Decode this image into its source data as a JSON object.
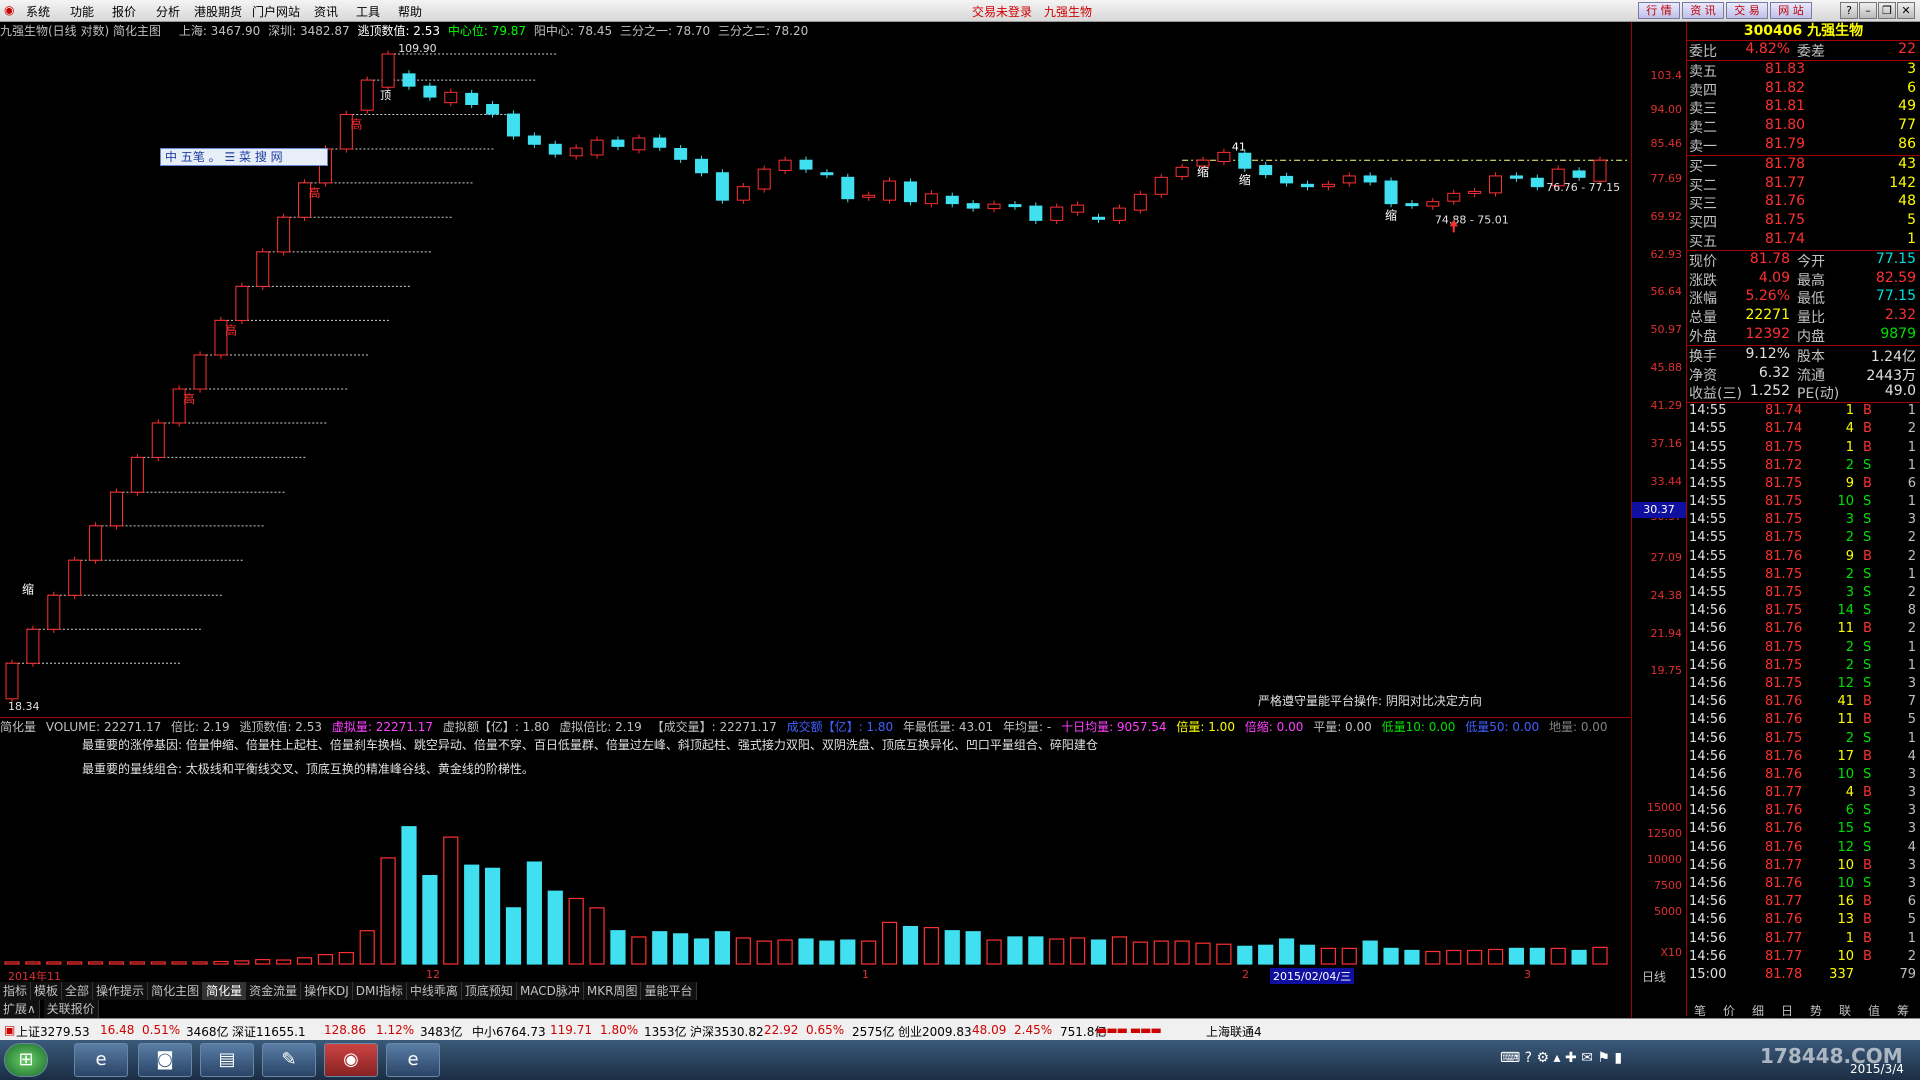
{
  "titlebar": {
    "menu": [
      "系统",
      "功能",
      "报价",
      "分析",
      "港股期货",
      "门户网站",
      "资讯",
      "工具",
      "帮助"
    ],
    "status": "交易未登录",
    "stock_name": "九强生物",
    "right_buttons": [
      "行 情",
      "资 讯",
      "交 易",
      "网 站"
    ]
  },
  "chart_header": {
    "title": "九强生物(日线 对数) 简化主图",
    "sh": "上海: 3467.90",
    "sz": "深圳: 3482.87",
    "escape_top": "逃顶数值: 2.53",
    "center": "中心位: 79.87",
    "yang_center": "阳中心: 78.45",
    "third1": "三分之一: 78.70",
    "third2": "三分之二: 78.20"
  },
  "main_chart": {
    "annotations": {
      "high_price": "109.90",
      "low_price": "18.34",
      "range1": "74.88 - 75.01",
      "range2": "76.76 - 77.15",
      "label_41": "41",
      "note": "严格遵守量能平台操作: 阴阳对比决定方向",
      "ime": "中 五笔 。 ☰ 菜 搜 网",
      "gao": "高",
      "suo": "缩",
      "ding": "顶"
    },
    "price_axis": [
      "103.4",
      "94.00",
      "85.46",
      "77.69",
      "69.92",
      "62.93",
      "56.64",
      "50.97",
      "45.88",
      "41.29",
      "37.16",
      "33.44",
      "30.37",
      "27.09",
      "24.38",
      "21.94",
      "19.75"
    ],
    "cursor_price": "30.37"
  },
  "volume": {
    "header": {
      "name": "简化量",
      "volume": "VOLUME: 22271.17",
      "ratio": "倍比: 2.19",
      "escape": "逃顶数值: 2.53",
      "virtual_vol": "虚拟量: 22271.17",
      "virtual_amt": "虚拟额【亿】: 1.80",
      "virtual_ratio": "虚拟倍比: 2.19",
      "deal_vol": "【成交量】: 22271.17",
      "deal_amt": "成交额【亿】: 1.80",
      "year_low": "年最低量: 43.01",
      "year_avg": "年均量: -",
      "ten_day": "十日均量: 9057.54",
      "bei": "倍量: 1.00",
      "bei_suo": "倍缩: 0.00",
      "ping": "平量: 0.00",
      "low10": "低量10: 0.00",
      "low50": "低量50: 0.00",
      "di": "地量: 0.00"
    },
    "desc1": "最重要的涨停基因: 倍量伸缩、倍量柱上起柱、倍量刹车换档、跳空异动、倍量不穿、百日低量群、倍量过左峰、斜顶起柱、强式接力双阳、双阴洗盘、顶底互换异化、凹口平量组合、碎阳建仓",
    "desc2": "最重要的量线组合: 太极线和平衡线交叉、顶底互换的精准峰谷线、黄金线的阶梯性。",
    "axis": [
      "15000",
      "12500",
      "10000",
      "7500",
      "5000",
      "X10"
    ]
  },
  "date_axis": {
    "start": "2014年11",
    "m12": "12",
    "m1": "1",
    "m2": "2",
    "highlight": "2015/02/04/三",
    "m3": "3",
    "period": "日线"
  },
  "tabs": [
    "指标",
    "模板",
    "全部",
    "操作提示",
    "简化主图",
    "简化量",
    "资金流量",
    "操作KDJ",
    "DMI指标",
    "中线乖离",
    "顶底预知",
    "MACD脉冲",
    "MKR周图",
    "量能平台"
  ],
  "subtabs": [
    "扩展∧",
    "关联报价"
  ],
  "quote": {
    "code_name": "300406 九强生物",
    "weibi": {
      "label": "委比",
      "value": "4.82%",
      "label2": "委差",
      "value2": "22"
    },
    "sells": [
      {
        "label": "卖五",
        "price": "81.83",
        "vol": "3"
      },
      {
        "label": "卖四",
        "price": "81.82",
        "vol": "6"
      },
      {
        "label": "卖三",
        "price": "81.81",
        "vol": "49"
      },
      {
        "label": "卖二",
        "price": "81.80",
        "vol": "77"
      },
      {
        "label": "卖一",
        "price": "81.79",
        "vol": "86"
      }
    ],
    "buys": [
      {
        "label": "买一",
        "price": "81.78",
        "vol": "43"
      },
      {
        "label": "买二",
        "price": "81.77",
        "vol": "142"
      },
      {
        "label": "买三",
        "price": "81.76",
        "vol": "48"
      },
      {
        "label": "买四",
        "price": "81.75",
        "vol": "5"
      },
      {
        "label": "买五",
        "price": "81.74",
        "vol": "1"
      }
    ],
    "stats": [
      {
        "l1": "现价",
        "v1": "81.78",
        "l2": "今开",
        "v2": "77.15",
        "c1": "#ff3030",
        "c2": "#00e0e0"
      },
      {
        "l1": "涨跌",
        "v1": "4.09",
        "l2": "最高",
        "v2": "82.59",
        "c1": "#ff3030",
        "c2": "#ff3030"
      },
      {
        "l1": "涨幅",
        "v1": "5.26%",
        "l2": "最低",
        "v2": "77.15",
        "c1": "#ff3030",
        "c2": "#00e0e0"
      },
      {
        "l1": "总量",
        "v1": "22271",
        "l2": "量比",
        "v2": "2.32",
        "c1": "#ffff00",
        "c2": "#ff3030"
      },
      {
        "l1": "外盘",
        "v1": "12392",
        "l2": "内盘",
        "v2": "9879",
        "c1": "#ff3030",
        "c2": "#00e000"
      }
    ],
    "stats2": [
      {
        "l1": "换手",
        "v1": "9.12%",
        "l2": "股本",
        "v2": "1.24亿"
      },
      {
        "l1": "净资",
        "v1": "6.32",
        "l2": "流通",
        "v2": "2443万"
      },
      {
        "l1": "收益(三)",
        "v1": "1.252",
        "l2": "PE(动)",
        "v2": "49.0"
      }
    ],
    "ticks": [
      {
        "t": "14:55",
        "p": "81.74",
        "v": "1",
        "s": "B",
        "n": "1"
      },
      {
        "t": "14:55",
        "p": "81.74",
        "v": "4",
        "s": "B",
        "n": "2"
      },
      {
        "t": "14:55",
        "p": "81.75",
        "v": "1",
        "s": "B",
        "n": "1"
      },
      {
        "t": "14:55",
        "p": "81.72",
        "v": "2",
        "s": "S",
        "n": "1"
      },
      {
        "t": "14:55",
        "p": "81.75",
        "v": "9",
        "s": "B",
        "n": "6"
      },
      {
        "t": "14:55",
        "p": "81.75",
        "v": "10",
        "s": "S",
        "n": "1"
      },
      {
        "t": "14:55",
        "p": "81.75",
        "v": "3",
        "s": "S",
        "n": "3"
      },
      {
        "t": "14:55",
        "p": "81.75",
        "v": "2",
        "s": "S",
        "n": "2"
      },
      {
        "t": "14:55",
        "p": "81.76",
        "v": "9",
        "s": "B",
        "n": "2"
      },
      {
        "t": "14:55",
        "p": "81.75",
        "v": "2",
        "s": "S",
        "n": "1"
      },
      {
        "t": "14:55",
        "p": "81.75",
        "v": "3",
        "s": "S",
        "n": "2"
      },
      {
        "t": "14:56",
        "p": "81.75",
        "v": "14",
        "s": "S",
        "n": "8"
      },
      {
        "t": "14:56",
        "p": "81.76",
        "v": "11",
        "s": "B",
        "n": "2"
      },
      {
        "t": "14:56",
        "p": "81.75",
        "v": "2",
        "s": "S",
        "n": "1"
      },
      {
        "t": "14:56",
        "p": "81.75",
        "v": "2",
        "s": "S",
        "n": "1"
      },
      {
        "t": "14:56",
        "p": "81.75",
        "v": "12",
        "s": "S",
        "n": "3"
      },
      {
        "t": "14:56",
        "p": "81.76",
        "v": "41",
        "s": "B",
        "n": "7"
      },
      {
        "t": "14:56",
        "p": "81.76",
        "v": "11",
        "s": "B",
        "n": "5"
      },
      {
        "t": "14:56",
        "p": "81.75",
        "v": "2",
        "s": "S",
        "n": "1"
      },
      {
        "t": "14:56",
        "p": "81.76",
        "v": "17",
        "s": "B",
        "n": "4"
      },
      {
        "t": "14:56",
        "p": "81.76",
        "v": "10",
        "s": "S",
        "n": "3"
      },
      {
        "t": "14:56",
        "p": "81.77",
        "v": "4",
        "s": "B",
        "n": "3"
      },
      {
        "t": "14:56",
        "p": "81.76",
        "v": "6",
        "s": "S",
        "n": "3"
      },
      {
        "t": "14:56",
        "p": "81.76",
        "v": "15",
        "s": "S",
        "n": "3"
      },
      {
        "t": "14:56",
        "p": "81.76",
        "v": "12",
        "s": "S",
        "n": "4"
      },
      {
        "t": "14:56",
        "p": "81.77",
        "v": "10",
        "s": "B",
        "n": "3"
      },
      {
        "t": "14:56",
        "p": "81.76",
        "v": "10",
        "s": "S",
        "n": "3"
      },
      {
        "t": "14:56",
        "p": "81.77",
        "v": "16",
        "s": "B",
        "n": "6"
      },
      {
        "t": "14:56",
        "p": "81.76",
        "v": "13",
        "s": "B",
        "n": "5"
      },
      {
        "t": "14:56",
        "p": "81.77",
        "v": "1",
        "s": "B",
        "n": "1"
      },
      {
        "t": "14:56",
        "p": "81.77",
        "v": "10",
        "s": "B",
        "n": "2"
      },
      {
        "t": "15:00",
        "p": "81.78",
        "v": "337",
        "s": "",
        "n": "79"
      }
    ],
    "panel_tabs": [
      "笔",
      "价",
      "细",
      "日",
      "势",
      "联",
      "值",
      "筹"
    ]
  },
  "statusbar": {
    "sh": "上证3279.53",
    "sh_chg": "16.48",
    "sh_pct": "0.51%",
    "sh_amt": "3468亿",
    "sz": "深证11655.1",
    "sz_chg": "128.86",
    "sz_pct": "1.12%",
    "sz_amt": "3483亿",
    "zx": "中小6764.73",
    "zx_chg": "119.71",
    "zx_pct": "1.80%",
    "zx_amt": "1353亿",
    "hs": "沪深3530.82",
    "hs_chg": "22.92",
    "hs_pct": "0.65%",
    "hs_amt": "2575亿",
    "cy": "创业2009.83",
    "cy_chg": "48.09",
    "cy_pct": "2.45%",
    "cy_amt": "751.8亿",
    "server": "上海联通4"
  },
  "taskbar": {
    "date": "2015/3/4",
    "watermark": "178448.COM"
  },
  "chart_data": {
    "type": "candlestick",
    "title": "九强生物(日线 对数) 简化主图",
    "ylim": [
      18.34,
      109.9
    ],
    "yscale": "log",
    "candles": [
      {
        "o": 18.3,
        "c": 20.2
      },
      {
        "o": 20.2,
        "c": 22.2
      },
      {
        "o": 22.2,
        "c": 24.4
      },
      {
        "o": 24.4,
        "c": 26.9
      },
      {
        "o": 26.9,
        "c": 29.6
      },
      {
        "o": 29.6,
        "c": 32.5
      },
      {
        "o": 32.5,
        "c": 35.8
      },
      {
        "o": 35.8,
        "c": 39.4
      },
      {
        "o": 39.4,
        "c": 43.3
      },
      {
        "o": 43.3,
        "c": 47.6
      },
      {
        "o": 47.6,
        "c": 52.4
      },
      {
        "o": 52.4,
        "c": 57.6
      },
      {
        "o": 57.6,
        "c": 63.4
      },
      {
        "o": 63.4,
        "c": 69.8
      },
      {
        "o": 69.8,
        "c": 76.8
      },
      {
        "o": 76.8,
        "c": 84.4
      },
      {
        "o": 84.4,
        "c": 92.9
      },
      {
        "o": 94.0,
        "c": 102.2
      },
      {
        "o": 100.2,
        "c": 109.9
      },
      {
        "o": 104.0,
        "c": 100.5
      },
      {
        "o": 100.5,
        "c": 97.5
      },
      {
        "o": 96.0,
        "c": 98.8
      },
      {
        "o": 98.5,
        "c": 95.5
      },
      {
        "o": 95.5,
        "c": 93.0
      },
      {
        "o": 93.0,
        "c": 87.5
      },
      {
        "o": 87.5,
        "c": 85.5
      },
      {
        "o": 85.5,
        "c": 83.2
      },
      {
        "o": 82.8,
        "c": 84.6
      },
      {
        "o": 83.0,
        "c": 86.5
      },
      {
        "o": 86.5,
        "c": 85.0
      },
      {
        "o": 84.2,
        "c": 87.0
      },
      {
        "o": 87.0,
        "c": 84.8
      },
      {
        "o": 84.5,
        "c": 82.0
      },
      {
        "o": 82.0,
        "c": 79.0
      },
      {
        "o": 79.0,
        "c": 73.2
      },
      {
        "o": 73.2,
        "c": 76.0
      },
      {
        "o": 75.5,
        "c": 79.8
      },
      {
        "o": 79.5,
        "c": 81.8
      },
      {
        "o": 81.8,
        "c": 79.8
      },
      {
        "o": 79.0,
        "c": 78.6
      },
      {
        "o": 78.0,
        "c": 73.5
      },
      {
        "o": 73.8,
        "c": 74.2
      },
      {
        "o": 73.2,
        "c": 77.2
      },
      {
        "o": 77.0,
        "c": 72.9
      },
      {
        "o": 72.5,
        "c": 74.5
      },
      {
        "o": 74.0,
        "c": 72.5
      },
      {
        "o": 72.5,
        "c": 71.6
      },
      {
        "o": 71.5,
        "c": 72.4
      },
      {
        "o": 72.3,
        "c": 72.0
      },
      {
        "o": 72.0,
        "c": 69.2
      },
      {
        "o": 69.2,
        "c": 71.8
      },
      {
        "o": 70.8,
        "c": 72.2
      },
      {
        "o": 69.8,
        "c": 69.4
      },
      {
        "o": 69.2,
        "c": 71.6
      },
      {
        "o": 71.2,
        "c": 74.4
      },
      {
        "o": 74.4,
        "c": 78.0
      },
      {
        "o": 78.2,
        "c": 80.2
      },
      {
        "o": 80.5,
        "c": 81.8
      },
      {
        "o": 81.5,
        "c": 83.6
      },
      {
        "o": 83.4,
        "c": 80.0
      },
      {
        "o": 80.6,
        "c": 78.6
      },
      {
        "o": 78.2,
        "c": 76.8
      },
      {
        "o": 76.5,
        "c": 76.0
      },
      {
        "o": 76.0,
        "c": 76.5
      },
      {
        "o": 76.8,
        "c": 78.3
      },
      {
        "o": 78.3,
        "c": 77.0
      },
      {
        "o": 77.2,
        "c": 72.5
      },
      {
        "o": 72.5,
        "c": 72.2
      },
      {
        "o": 72.0,
        "c": 72.9
      },
      {
        "o": 73.0,
        "c": 74.6
      },
      {
        "o": 74.6,
        "c": 75.0
      },
      {
        "o": 74.7,
        "c": 78.3
      },
      {
        "o": 78.3,
        "c": 77.8
      },
      {
        "o": 77.8,
        "c": 76.0
      },
      {
        "o": 76.2,
        "c": 79.8
      },
      {
        "o": 79.4,
        "c": 78.0
      },
      {
        "o": 77.15,
        "c": 81.78
      }
    ],
    "volume": [
      55,
      60,
      48,
      70,
      52,
      66,
      90,
      120,
      150,
      180,
      240,
      300,
      420,
      380,
      600,
      900,
      1100,
      3200,
      10200,
      13200,
      8500,
      12200,
      9500,
      9200,
      5400,
      9800,
      7000,
      6300,
      5400,
      3200,
      2600,
      3100,
      2900,
      2400,
      3100,
      2500,
      2200,
      2300,
      2400,
      2200,
      2300,
      2200,
      4000,
      3600,
      3500,
      3200,
      3100,
      2300,
      2600,
      2600,
      2400,
      2500,
      2300,
      2600,
      2100,
      2200,
      2200,
      2000,
      1900,
      1700,
      1800,
      2400,
      1800,
      1500,
      1500,
      2200,
      1500,
      1300,
      1200,
      1300,
      1300,
      1400,
      1500,
      1500,
      1500,
      1300,
      1600
    ]
  }
}
